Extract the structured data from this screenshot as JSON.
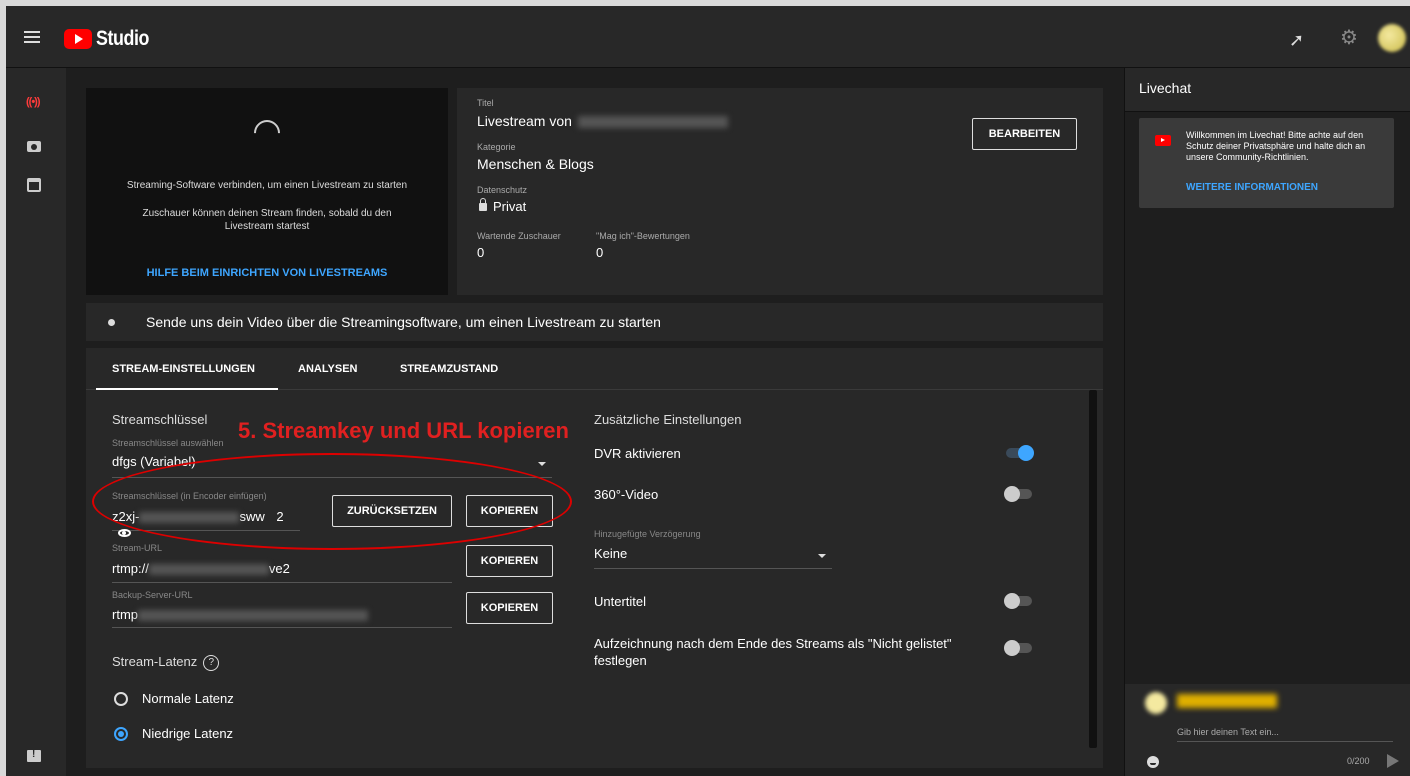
{
  "app": {
    "name": "Studio"
  },
  "topbar": {
    "share_glyph": "➚",
    "gear_glyph": "⚙"
  },
  "sidebar": {
    "live_glyph": "((•))"
  },
  "preview": {
    "text1": "Streaming-Software verbinden, um einen Livestream zu starten",
    "text2": "Zuschauer können deinen Stream finden, sobald du den Livestream startest",
    "help_link": "HILFE BEIM EINRICHTEN VON LIVESTREAMS"
  },
  "info": {
    "title_label": "Titel",
    "title_value": "Livestream von",
    "category_label": "Kategorie",
    "category_value": "Menschen & Blogs",
    "privacy_label": "Datenschutz",
    "privacy_value": "Privat",
    "waiting_label": "Wartende Zuschauer",
    "waiting_value": "0",
    "likes_label": "\"Mag ich\"-Bewertungen",
    "likes_value": "0",
    "edit_button": "BEARBEITEN"
  },
  "status": {
    "text": "Sende uns dein Video über die Streamingsoftware, um einen Livestream zu starten"
  },
  "tabs": [
    {
      "label": "STREAM-EINSTELLUNGEN",
      "active": true
    },
    {
      "label": "ANALYSEN",
      "active": false
    },
    {
      "label": "STREAMZUSTAND",
      "active": false
    }
  ],
  "stream_key": {
    "section_title": "Streamschlüssel",
    "select_label": "Streamschlüssel auswählen",
    "select_value": "dfgs (Variabel)",
    "key_label": "Streamschlüssel (in Encoder einfügen)",
    "key_prefix": "z2xj-",
    "key_suffix": "sww",
    "key_count": "2",
    "reset_button": "ZURÜCKSETZEN",
    "copy_button": "KOPIEREN",
    "url_label": "Stream-URL",
    "url_prefix": "rtmp://",
    "url_suffix": "ve2",
    "backup_label": "Backup-Server-URL",
    "backup_prefix": "rtmp"
  },
  "latency": {
    "title": "Stream-Latenz",
    "help_glyph": "?",
    "options": [
      {
        "label": "Normale Latenz",
        "selected": false
      },
      {
        "label": "Niedrige Latenz",
        "selected": true
      }
    ]
  },
  "annotation": {
    "text": "5. Streamkey und URL kopieren",
    "color": "#e02020"
  },
  "extra": {
    "title": "Zusätzliche Einstellungen",
    "dvr": {
      "label": "DVR aktivieren",
      "on": true
    },
    "video360": {
      "label": "360°-Video",
      "on": false
    },
    "delay_label": "Hinzugefügte Verzögerung",
    "delay_value": "Keine",
    "subtitles": {
      "label": "Untertitel",
      "on": false
    },
    "unlisted": {
      "label": "Aufzeichnung nach dem Ende des Streams als \"Nicht gelistet\" festlegen",
      "on": false
    }
  },
  "chat": {
    "title": "Livechat",
    "welcome": "Willkommen im Livechat! Bitte achte auf den Schutz deiner Privatsphäre und halte dich an unsere Community-Richtlinien.",
    "more_link": "WEITERE INFORMATIONEN",
    "input_placeholder": "Gib hier deinen Text ein...",
    "char_count": "0/200"
  },
  "colors": {
    "accent": "#3ea6ff",
    "brand": "#ff0000",
    "background": "#1e1e1e",
    "surface": "#282828"
  }
}
